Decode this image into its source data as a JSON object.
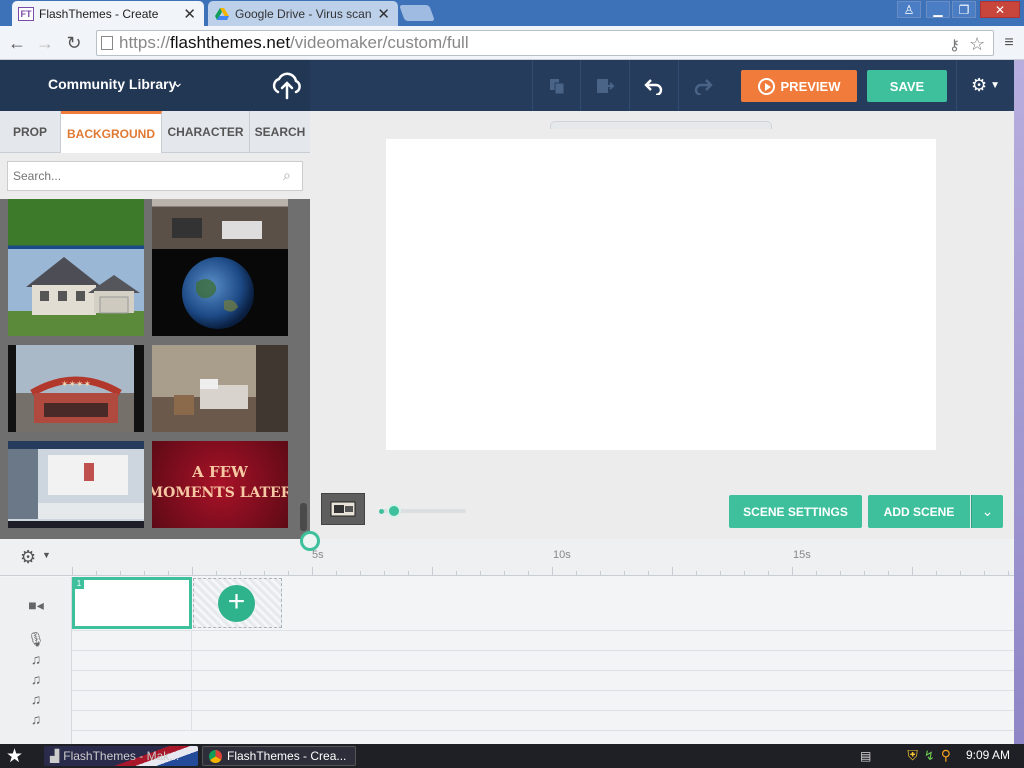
{
  "browser": {
    "tabs": [
      {
        "title": "FlashThemes - Create",
        "favicon": "FT",
        "active": true
      },
      {
        "title": "Google Drive - Virus scan wa",
        "favicon": "drive",
        "active": false
      }
    ],
    "url_scheme": "https://",
    "url_host": "flashthemes.net",
    "url_path": "/videomaker/custom/full"
  },
  "header": {
    "library_title": "Community Library",
    "preview_label": "PREVIEW",
    "save_label": "SAVE",
    "colors": {
      "preview": "#f07b3a",
      "save": "#3ec09c",
      "header": "#253c5c"
    }
  },
  "library": {
    "tabs": [
      "PROP",
      "BACKGROUND",
      "CHARACTER",
      "SEARCH"
    ],
    "active_tab": "BACKGROUND",
    "search_placeholder": "Search...",
    "thumbnail_text": "A FEW MOMENTS LATER"
  },
  "stage": {
    "scene_settings_label": "SCENE SETTINGS",
    "add_scene_label": "ADD SCENE"
  },
  "timeline": {
    "ticks": [
      "5s",
      "10s",
      "15s"
    ],
    "scene_number": "1"
  },
  "taskbar": {
    "items": [
      "FlashThemes - Mak...",
      "FlashThemes - Crea..."
    ],
    "clock": "9:09 AM"
  }
}
